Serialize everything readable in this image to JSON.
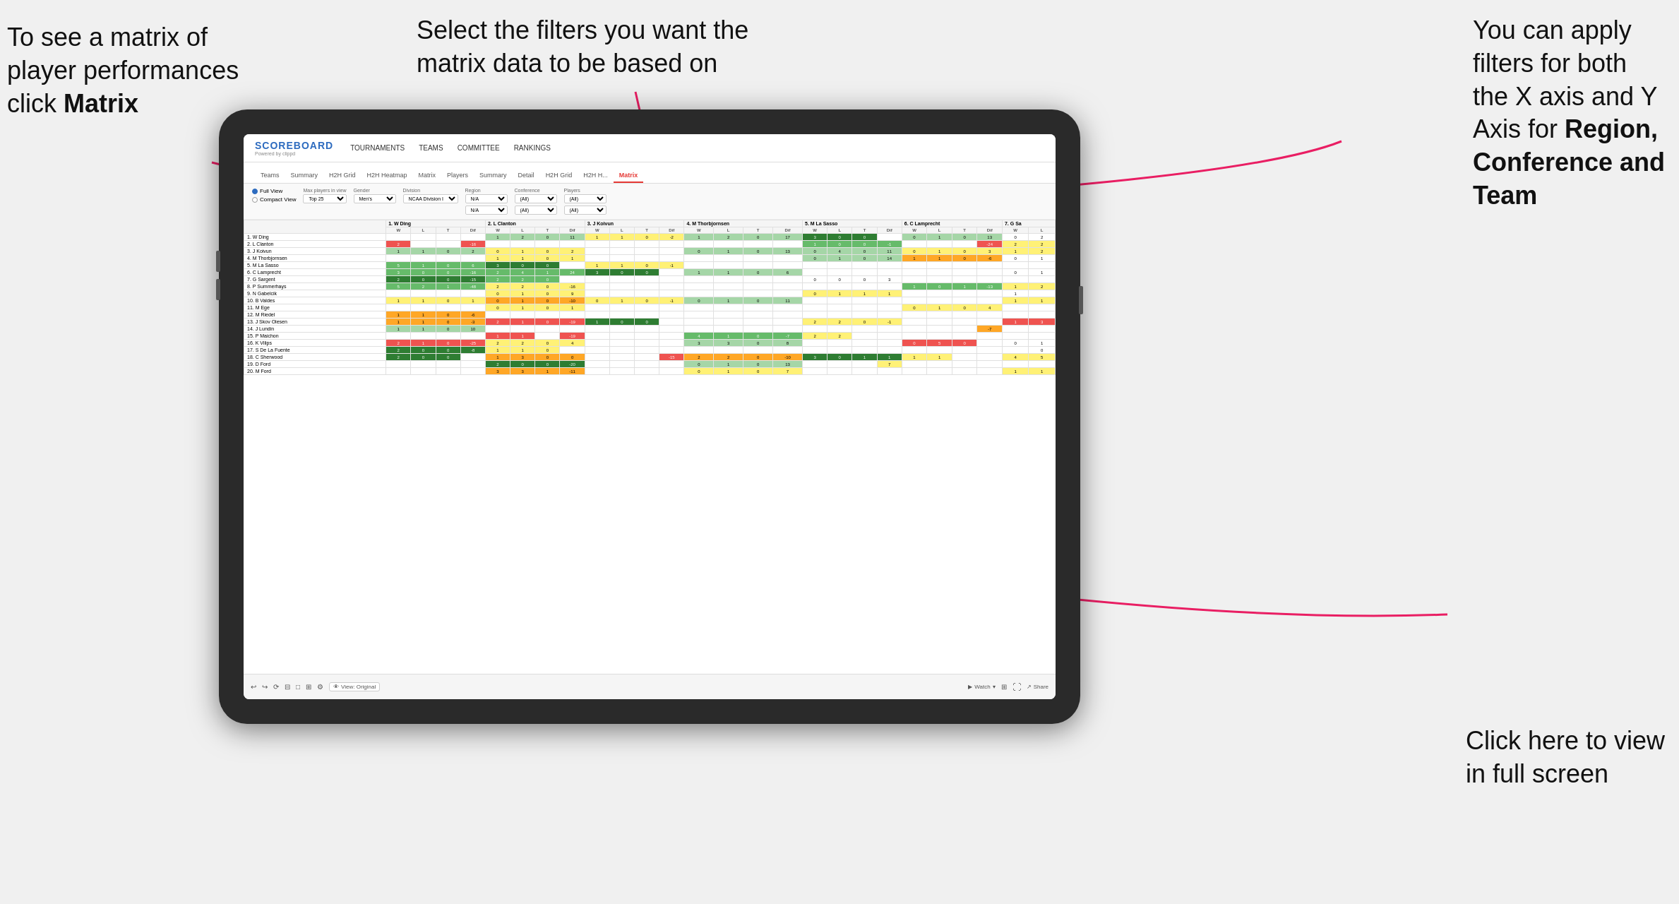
{
  "annotations": {
    "top_left": {
      "line1": "To see a matrix of",
      "line2": "player performances",
      "line3_prefix": "click ",
      "line3_bold": "Matrix"
    },
    "top_center": {
      "line1": "Select the filters you want the",
      "line2": "matrix data to be based on"
    },
    "top_right": {
      "line1": "You  can apply",
      "line2": "filters for both",
      "line3": "the X axis and Y",
      "line4_prefix": "Axis for ",
      "line4_bold": "Region,",
      "line5_bold": "Conference and",
      "line6_bold": "Team"
    },
    "bottom_right": {
      "line1": "Click here to view",
      "line2": "in full screen"
    }
  },
  "app": {
    "logo_title": "SCOREBOARD",
    "logo_sub": "Powered by clippd",
    "nav": [
      "TOURNAMENTS",
      "TEAMS",
      "COMMITTEE",
      "RANKINGS"
    ],
    "sub_tabs": [
      {
        "label": "Teams",
        "active": false
      },
      {
        "label": "Summary",
        "active": false
      },
      {
        "label": "H2H Grid",
        "active": false
      },
      {
        "label": "H2H Heatmap",
        "active": false
      },
      {
        "label": "Matrix",
        "active": false
      },
      {
        "label": "Players",
        "active": false
      },
      {
        "label": "Summary",
        "active": false
      },
      {
        "label": "Detail",
        "active": false
      },
      {
        "label": "H2H Grid",
        "active": false
      },
      {
        "label": "H2H H...",
        "active": false
      },
      {
        "label": "Matrix",
        "active": true
      }
    ],
    "filters": {
      "view_full": "Full View",
      "view_compact": "Compact View",
      "max_players_label": "Max players in view",
      "max_players_val": "Top 25",
      "gender_label": "Gender",
      "gender_val": "Men's",
      "division_label": "Division",
      "division_val": "NCAA Division I",
      "region_label": "Region",
      "region_val1": "N/A",
      "region_val2": "N/A",
      "conference_label": "Conference",
      "conference_val1": "(All)",
      "conference_val2": "(All)",
      "players_label": "Players",
      "players_val1": "(All)",
      "players_val2": "(All)"
    },
    "col_headers": [
      "1. W Ding",
      "2. L Clanton",
      "3. J Koivun",
      "4. M Thorbjornsen",
      "5. M La Sasso",
      "6. C Lamprecht",
      "7. G Sa"
    ],
    "sub_headers": [
      "W",
      "L",
      "T",
      "Dif"
    ],
    "players": [
      "1. W Ding",
      "2. L Clanton",
      "3. J Koivun",
      "4. M Thorbjornsen",
      "5. M La Sasso",
      "6. C Lamprecht",
      "7. G Sargent",
      "8. P Summerhays",
      "9. N Gabelcik",
      "10. B Valdes",
      "11. M Ege",
      "12. M Riedel",
      "13. J Skov Olesen",
      "14. J Lundin",
      "15. P Maichon",
      "16. K Vilips",
      "17. S De La Fuente",
      "18. C Sherwood",
      "19. D Ford",
      "20. M Ford"
    ],
    "toolbar": {
      "view_original": "View: Original",
      "watch": "Watch",
      "share": "Share"
    }
  }
}
